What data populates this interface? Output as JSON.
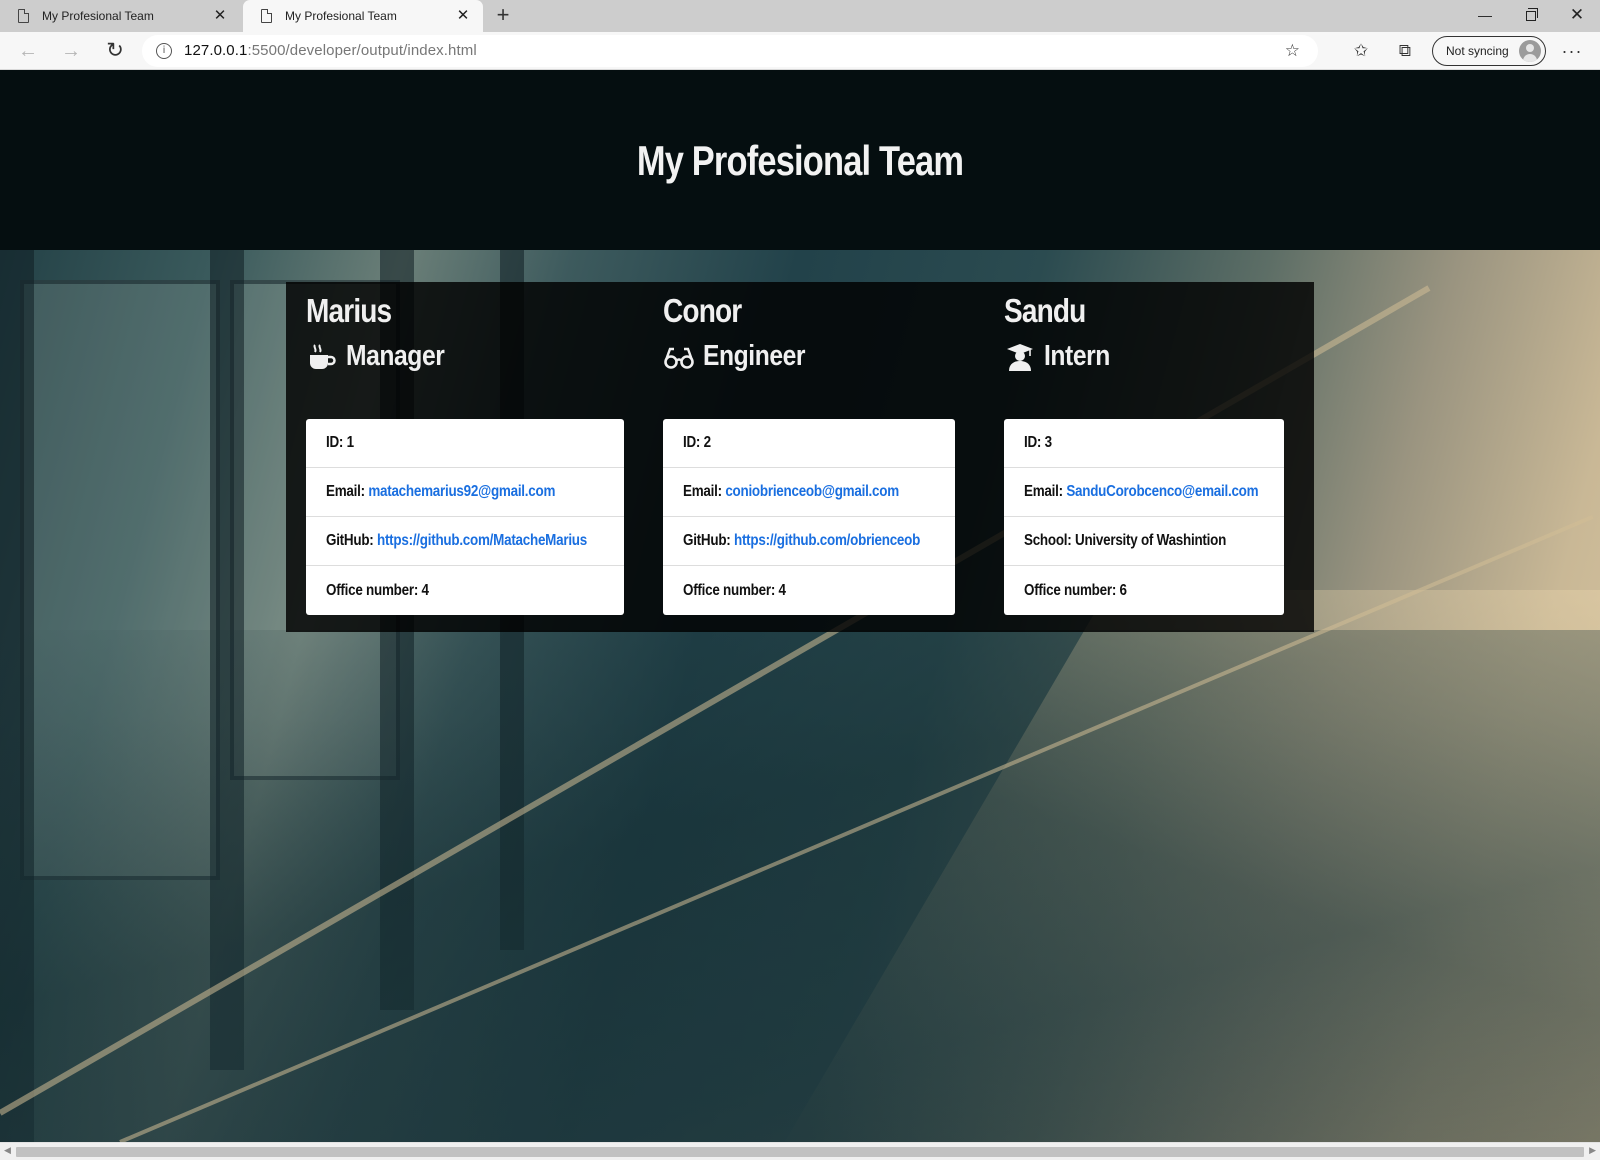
{
  "browser": {
    "tabs": [
      {
        "title": "My Profesional Team",
        "active": false
      },
      {
        "title": "My Profesional Team",
        "active": true
      }
    ],
    "new_tab": "+",
    "url_host": "127.0.0.1",
    "url_rest": ":5500/developer/output/index.html",
    "sync_label": "Not syncing",
    "window_controls": {
      "minimize": "—",
      "close": "✕"
    }
  },
  "page": {
    "title": "My Profesional Team",
    "members": [
      {
        "name": "Marius",
        "role": "Manager",
        "role_icon": "coffee-icon",
        "id_label": "ID:",
        "id": "1",
        "email_label": "Email:",
        "email": "matachemarius92@gmail.com",
        "third_label": "GitHub:",
        "third_value": "https://github.com/MatacheMarius",
        "third_is_link": true,
        "office_label": "Office number:",
        "office": "4"
      },
      {
        "name": "Conor",
        "role": "Engineer",
        "role_icon": "glasses-icon",
        "id_label": "ID:",
        "id": "2",
        "email_label": "Email:",
        "email": "coniobrienceob@gmail.com",
        "third_label": "GitHub:",
        "third_value": "https://github.com/obrienceob",
        "third_is_link": true,
        "office_label": "Office number:",
        "office": "4"
      },
      {
        "name": "Sandu",
        "role": "Intern",
        "role_icon": "graduate-icon",
        "id_label": "ID:",
        "id": "3",
        "email_label": "Email:",
        "email": "SanduCorobcenco@email.com",
        "third_label": "School:",
        "third_value": "University of Washintion",
        "third_is_link": false,
        "office_label": "Office number:",
        "office": "6"
      }
    ]
  },
  "colors": {
    "hero_bg": "#050e10",
    "panel_bg": "rgba(0,0,0,0.82)",
    "link": "#1a6fe0",
    "heading_text": "#f0f0f0"
  }
}
